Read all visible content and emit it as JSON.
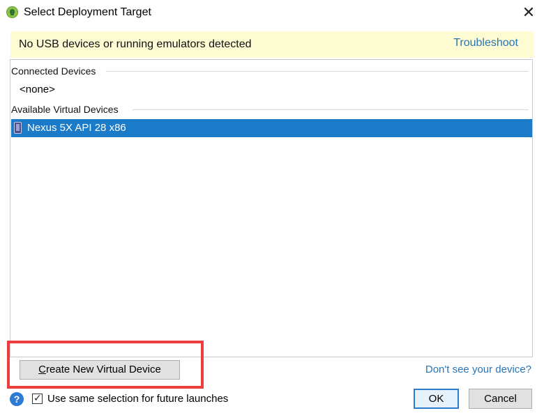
{
  "window": {
    "title": "Select Deployment Target",
    "close_symbol": "✕"
  },
  "banner": {
    "message": "No USB devices or running emulators detected",
    "link": "Troubleshoot"
  },
  "device_list": {
    "connected_header": "Connected Devices",
    "connected_empty": "<none>",
    "available_header": "Available Virtual Devices",
    "devices": [
      {
        "name": "Nexus 5X API 28 x86",
        "icon": "phone-icon",
        "selected": true
      }
    ]
  },
  "actions": {
    "create_button": "Create New Virtual Device",
    "create_mnemonic": "C",
    "create_rest": "reate New Virtual Device",
    "dont_see_link": "Don't see your device?"
  },
  "footer": {
    "help_symbol": "?",
    "checkbox_label": "Use same selection for future launches",
    "checkbox_checked": true,
    "check_symbol": "✓",
    "ok_label": "OK",
    "cancel_label": "Cancel"
  },
  "colors": {
    "selection": "#1b7bc8",
    "link": "#2874b8",
    "banner_bg": "#fdfcd3",
    "highlight": "#ef3c3c"
  }
}
